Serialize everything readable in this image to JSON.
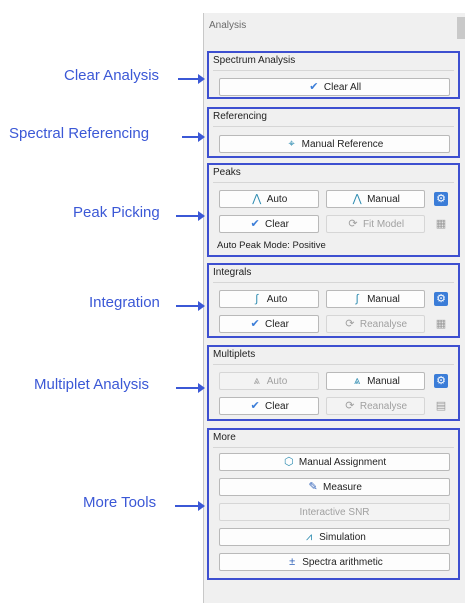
{
  "panel": {
    "title": "Analysis"
  },
  "callouts": {
    "clear_analysis": "Clear Analysis",
    "spectral_referencing": "Spectral Referencing",
    "peak_picking": "Peak Picking",
    "integration": "Integration",
    "multiplet_analysis": "Multiplet Analysis",
    "more_tools": "More Tools"
  },
  "spectrum_analysis": {
    "title": "Spectrum Analysis",
    "clear_all": "Clear All"
  },
  "referencing": {
    "title": "Referencing",
    "manual_reference": "Manual Reference"
  },
  "peaks": {
    "title": "Peaks",
    "auto": "Auto",
    "manual": "Manual",
    "clear": "Clear",
    "fit_model": "Fit Model",
    "status": "Auto Peak Mode: Positive"
  },
  "integrals": {
    "title": "Integrals",
    "auto": "Auto",
    "manual": "Manual",
    "clear": "Clear",
    "reanalyse": "Reanalyse"
  },
  "multiplets": {
    "title": "Multiplets",
    "auto": "Auto",
    "manual": "Manual",
    "clear": "Clear",
    "reanalyse": "Reanalyse"
  },
  "more": {
    "title": "More",
    "manual_assignment": "Manual Assignment",
    "measure": "Measure",
    "interactive_snr": "Interactive SNR",
    "simulation": "Simulation",
    "spectra_arithmetic": "Spectra arithmetic"
  },
  "colors": {
    "annotation": "#3b58d6",
    "accent": "#3b7dd8"
  },
  "icons": {
    "clear_all": "brush-icon",
    "manual_reference": "reference-icon",
    "peak_auto": "peak-auto-icon",
    "peak_manual": "peak-manual-icon",
    "peak_clear": "brush-icon",
    "fit_model": "refresh-icon",
    "settings": "gear-icon",
    "calendar": "calendar-icon",
    "integral_auto": "integral-icon",
    "integral_manual": "integral-manual-icon",
    "reanalyse": "refresh-icon",
    "document": "document-icon",
    "multiplet": "multiplet-icon",
    "assignment": "assignment-icon",
    "measure": "ruler-icon",
    "simulation": "simulation-icon",
    "arithmetic": "plus-minus-icon"
  }
}
